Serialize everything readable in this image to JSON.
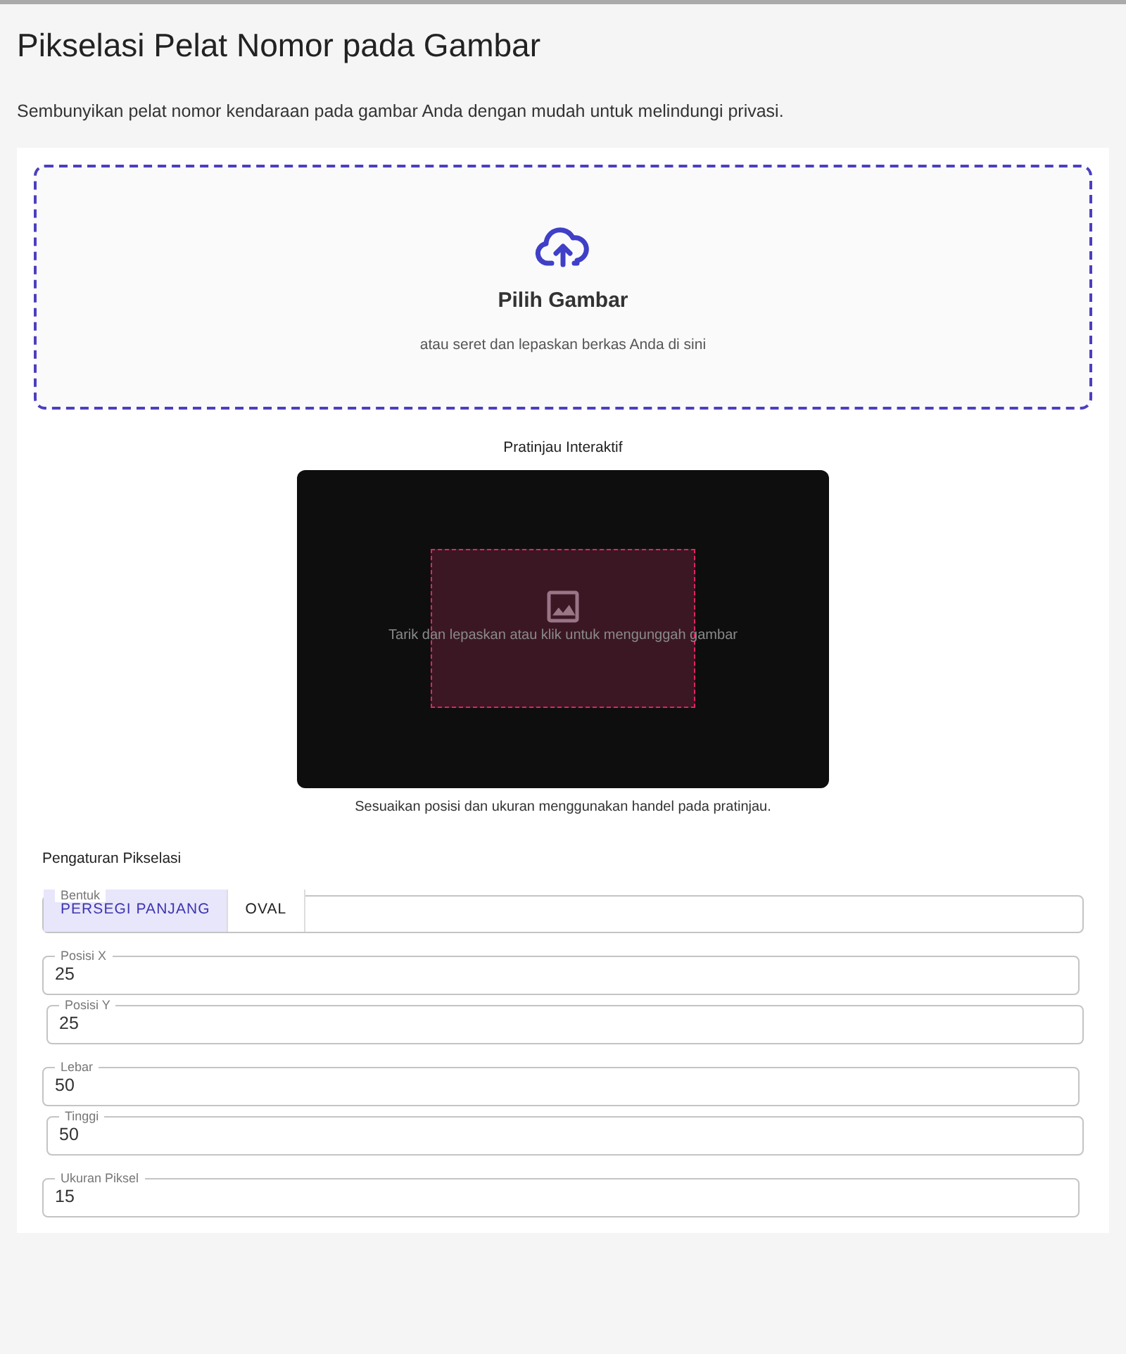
{
  "title": "Pikselasi Pelat Nomor pada Gambar",
  "subtitle": "Sembunyikan pelat nomor kendaraan pada gambar Anda dengan mudah untuk melindungi privasi.",
  "upload": {
    "button": "Pilih Gambar",
    "hint": "atau seret dan lepaskan berkas Anda di sini"
  },
  "preview": {
    "title": "Pratinjau Interaktif",
    "placeholder": "Tarik dan lepaskan atau klik untuk mengunggah gambar",
    "caption": "Sesuaikan posisi dan ukuran menggunakan handel pada pratinjau."
  },
  "settings": {
    "title": "Pengaturan Pikselasi",
    "shape": {
      "label": "Bentuk",
      "options": [
        {
          "label": "PERSEGI PANJANG",
          "selected": true
        },
        {
          "label": "OVAL",
          "selected": false
        }
      ]
    },
    "fields": [
      {
        "label": "Posisi X",
        "value": "25"
      },
      {
        "label": "Posisi Y",
        "value": "25"
      },
      {
        "label": "Lebar",
        "value": "50"
      },
      {
        "label": "Tinggi",
        "value": "50"
      },
      {
        "label": "Ukuran Piksel",
        "value": "15"
      }
    ]
  }
}
